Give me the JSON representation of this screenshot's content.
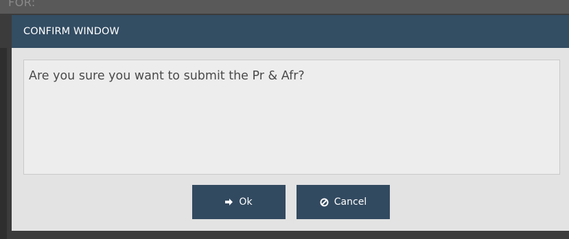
{
  "background": {
    "partial_text": "FOR:"
  },
  "dialog": {
    "title": "CONFIRM WINDOW",
    "message": "Are you sure you want to submit the Pr & Afr?",
    "buttons": {
      "ok": {
        "label": "Ok",
        "icon": "sign-in-icon"
      },
      "cancel": {
        "label": "Cancel",
        "icon": "ban-icon"
      }
    }
  },
  "colors": {
    "header": "#334d63",
    "button": "#324a60",
    "body": "#e3e3e3",
    "message_box": "#ededed"
  }
}
